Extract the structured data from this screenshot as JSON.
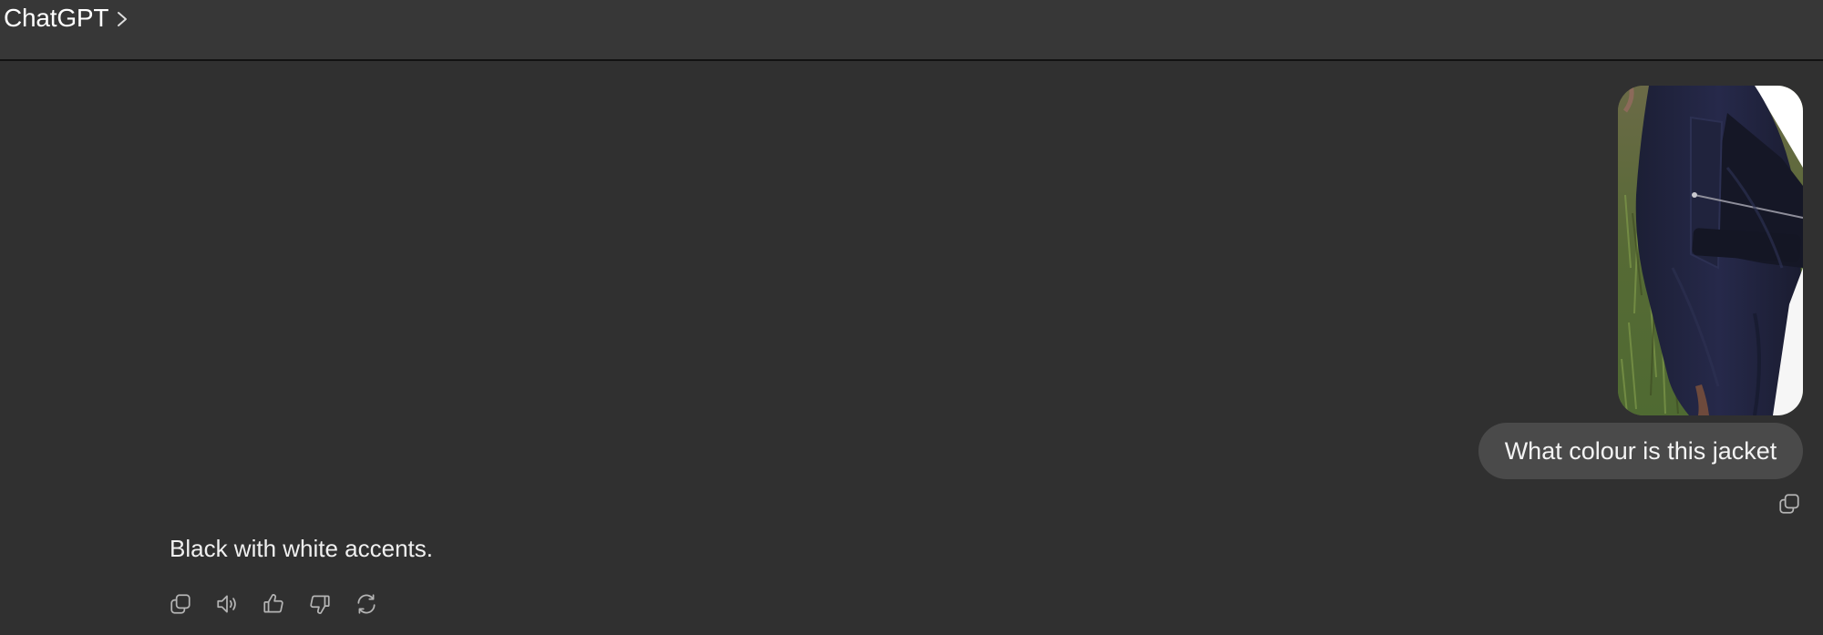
{
  "header": {
    "app_title": "ChatGPT",
    "title_chevron_icon": "chevron-right-icon"
  },
  "conversation": {
    "user_message": {
      "image": {
        "subject": "jacket photo",
        "colors": {
          "jacket": "#1e2139",
          "grass": "#5e6b3f",
          "accent": "#ffffff"
        }
      },
      "text": "What colour is this jacket",
      "actions": [
        {
          "name": "copy",
          "icon": "copy-icon"
        }
      ]
    },
    "assistant_message": {
      "text": "Black with white accents.",
      "actions": [
        {
          "name": "copy",
          "icon": "copy-icon"
        },
        {
          "name": "read-aloud",
          "icon": "speaker-icon"
        },
        {
          "name": "good-response",
          "icon": "thumbs-up-icon"
        },
        {
          "name": "bad-response",
          "icon": "thumbs-down-icon"
        },
        {
          "name": "regenerate",
          "icon": "refresh-icon"
        }
      ]
    }
  },
  "colors": {
    "background": "#303030",
    "header_background": "#373737",
    "user_bubble": "#4a4a4a",
    "text": "#ececec",
    "icon": "#b4b4b4"
  }
}
